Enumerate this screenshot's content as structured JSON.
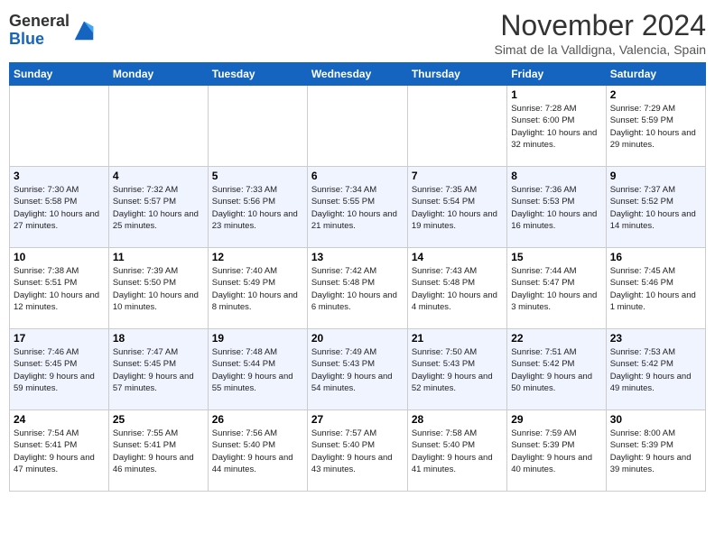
{
  "logo": {
    "general": "General",
    "blue": "Blue"
  },
  "header": {
    "month": "November 2024",
    "location": "Simat de la Valldigna, Valencia, Spain"
  },
  "weekdays": [
    "Sunday",
    "Monday",
    "Tuesday",
    "Wednesday",
    "Thursday",
    "Friday",
    "Saturday"
  ],
  "weeks": [
    [
      {
        "day": "",
        "info": ""
      },
      {
        "day": "",
        "info": ""
      },
      {
        "day": "",
        "info": ""
      },
      {
        "day": "",
        "info": ""
      },
      {
        "day": "",
        "info": ""
      },
      {
        "day": "1",
        "info": "Sunrise: 7:28 AM\nSunset: 6:00 PM\nDaylight: 10 hours and 32 minutes."
      },
      {
        "day": "2",
        "info": "Sunrise: 7:29 AM\nSunset: 5:59 PM\nDaylight: 10 hours and 29 minutes."
      }
    ],
    [
      {
        "day": "3",
        "info": "Sunrise: 7:30 AM\nSunset: 5:58 PM\nDaylight: 10 hours and 27 minutes."
      },
      {
        "day": "4",
        "info": "Sunrise: 7:32 AM\nSunset: 5:57 PM\nDaylight: 10 hours and 25 minutes."
      },
      {
        "day": "5",
        "info": "Sunrise: 7:33 AM\nSunset: 5:56 PM\nDaylight: 10 hours and 23 minutes."
      },
      {
        "day": "6",
        "info": "Sunrise: 7:34 AM\nSunset: 5:55 PM\nDaylight: 10 hours and 21 minutes."
      },
      {
        "day": "7",
        "info": "Sunrise: 7:35 AM\nSunset: 5:54 PM\nDaylight: 10 hours and 19 minutes."
      },
      {
        "day": "8",
        "info": "Sunrise: 7:36 AM\nSunset: 5:53 PM\nDaylight: 10 hours and 16 minutes."
      },
      {
        "day": "9",
        "info": "Sunrise: 7:37 AM\nSunset: 5:52 PM\nDaylight: 10 hours and 14 minutes."
      }
    ],
    [
      {
        "day": "10",
        "info": "Sunrise: 7:38 AM\nSunset: 5:51 PM\nDaylight: 10 hours and 12 minutes."
      },
      {
        "day": "11",
        "info": "Sunrise: 7:39 AM\nSunset: 5:50 PM\nDaylight: 10 hours and 10 minutes."
      },
      {
        "day": "12",
        "info": "Sunrise: 7:40 AM\nSunset: 5:49 PM\nDaylight: 10 hours and 8 minutes."
      },
      {
        "day": "13",
        "info": "Sunrise: 7:42 AM\nSunset: 5:48 PM\nDaylight: 10 hours and 6 minutes."
      },
      {
        "day": "14",
        "info": "Sunrise: 7:43 AM\nSunset: 5:48 PM\nDaylight: 10 hours and 4 minutes."
      },
      {
        "day": "15",
        "info": "Sunrise: 7:44 AM\nSunset: 5:47 PM\nDaylight: 10 hours and 3 minutes."
      },
      {
        "day": "16",
        "info": "Sunrise: 7:45 AM\nSunset: 5:46 PM\nDaylight: 10 hours and 1 minute."
      }
    ],
    [
      {
        "day": "17",
        "info": "Sunrise: 7:46 AM\nSunset: 5:45 PM\nDaylight: 9 hours and 59 minutes."
      },
      {
        "day": "18",
        "info": "Sunrise: 7:47 AM\nSunset: 5:45 PM\nDaylight: 9 hours and 57 minutes."
      },
      {
        "day": "19",
        "info": "Sunrise: 7:48 AM\nSunset: 5:44 PM\nDaylight: 9 hours and 55 minutes."
      },
      {
        "day": "20",
        "info": "Sunrise: 7:49 AM\nSunset: 5:43 PM\nDaylight: 9 hours and 54 minutes."
      },
      {
        "day": "21",
        "info": "Sunrise: 7:50 AM\nSunset: 5:43 PM\nDaylight: 9 hours and 52 minutes."
      },
      {
        "day": "22",
        "info": "Sunrise: 7:51 AM\nSunset: 5:42 PM\nDaylight: 9 hours and 50 minutes."
      },
      {
        "day": "23",
        "info": "Sunrise: 7:53 AM\nSunset: 5:42 PM\nDaylight: 9 hours and 49 minutes."
      }
    ],
    [
      {
        "day": "24",
        "info": "Sunrise: 7:54 AM\nSunset: 5:41 PM\nDaylight: 9 hours and 47 minutes."
      },
      {
        "day": "25",
        "info": "Sunrise: 7:55 AM\nSunset: 5:41 PM\nDaylight: 9 hours and 46 minutes."
      },
      {
        "day": "26",
        "info": "Sunrise: 7:56 AM\nSunset: 5:40 PM\nDaylight: 9 hours and 44 minutes."
      },
      {
        "day": "27",
        "info": "Sunrise: 7:57 AM\nSunset: 5:40 PM\nDaylight: 9 hours and 43 minutes."
      },
      {
        "day": "28",
        "info": "Sunrise: 7:58 AM\nSunset: 5:40 PM\nDaylight: 9 hours and 41 minutes."
      },
      {
        "day": "29",
        "info": "Sunrise: 7:59 AM\nSunset: 5:39 PM\nDaylight: 9 hours and 40 minutes."
      },
      {
        "day": "30",
        "info": "Sunrise: 8:00 AM\nSunset: 5:39 PM\nDaylight: 9 hours and 39 minutes."
      }
    ]
  ]
}
